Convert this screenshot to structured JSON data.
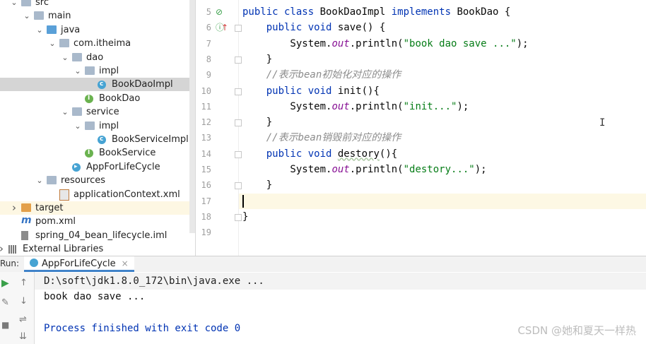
{
  "project_tree": {
    "items": [
      {
        "label": "src",
        "level": 1,
        "chevron": "down",
        "icon": "folder"
      },
      {
        "label": "main",
        "level": 2,
        "chevron": "down",
        "icon": "folder"
      },
      {
        "label": "java",
        "level": 3,
        "chevron": "down",
        "icon": "source-folder"
      },
      {
        "label": "com.itheima",
        "level": 4,
        "chevron": "down",
        "icon": "package"
      },
      {
        "label": "dao",
        "level": 5,
        "chevron": "down",
        "icon": "package"
      },
      {
        "label": "impl",
        "level": 6,
        "chevron": "down",
        "icon": "package"
      },
      {
        "label": "BookDaoImpl",
        "level": 7,
        "chevron": "",
        "icon": "class",
        "selected": true
      },
      {
        "label": "BookDao",
        "level": 6,
        "chevron": "",
        "icon": "interface"
      },
      {
        "label": "service",
        "level": 5,
        "chevron": "down",
        "icon": "package"
      },
      {
        "label": "impl",
        "level": 6,
        "chevron": "down",
        "icon": "package"
      },
      {
        "label": "BookServiceImpl",
        "level": 7,
        "chevron": "",
        "icon": "class"
      },
      {
        "label": "BookService",
        "level": 6,
        "chevron": "",
        "icon": "interface"
      },
      {
        "label": "AppForLifeCycle",
        "level": 5,
        "chevron": "",
        "icon": "run-class"
      },
      {
        "label": "resources",
        "level": 3,
        "chevron": "down",
        "icon": "resources-folder"
      },
      {
        "label": "applicationContext.xml",
        "level": 4,
        "chevron": "",
        "icon": "xml"
      },
      {
        "label": "target",
        "level": 1,
        "chevron": "right",
        "icon": "excluded-folder",
        "highlight": true
      },
      {
        "label": "pom.xml",
        "level": 1,
        "chevron": "",
        "icon": "maven"
      },
      {
        "label": "spring_04_bean_lifecycle.iml",
        "level": 1,
        "chevron": "",
        "icon": "iml"
      },
      {
        "label": "External Libraries",
        "level": 0,
        "chevron": "right",
        "icon": "library"
      }
    ]
  },
  "editor": {
    "lines": [
      {
        "num": "5",
        "segments": [
          [
            "kw",
            "public class "
          ],
          [
            "",
            "BookDaoImpl "
          ],
          [
            "kw",
            "implements "
          ],
          [
            "",
            "BookDao {"
          ]
        ]
      },
      {
        "num": "6",
        "segments": [
          [
            "",
            "    "
          ],
          [
            "kw",
            "public void "
          ],
          [
            "",
            "save() {"
          ]
        ]
      },
      {
        "num": "7",
        "segments": [
          [
            "",
            "        System."
          ],
          [
            "fld",
            "out"
          ],
          [
            "",
            ".println("
          ],
          [
            "str",
            "\"book dao save ...\""
          ],
          [
            "",
            ");"
          ]
        ]
      },
      {
        "num": "8",
        "segments": [
          [
            "",
            "    }"
          ]
        ]
      },
      {
        "num": "9",
        "segments": [
          [
            "",
            "    "
          ],
          [
            "cmt",
            "//表示bean初始化对应的操作"
          ]
        ]
      },
      {
        "num": "10",
        "segments": [
          [
            "",
            "    "
          ],
          [
            "kw",
            "public void "
          ],
          [
            "",
            "init(){"
          ]
        ]
      },
      {
        "num": "11",
        "segments": [
          [
            "",
            "        System."
          ],
          [
            "fld",
            "out"
          ],
          [
            "",
            ".println("
          ],
          [
            "str",
            "\"init...\""
          ],
          [
            "",
            ");"
          ]
        ]
      },
      {
        "num": "12",
        "segments": [
          [
            "",
            "    }"
          ]
        ]
      },
      {
        "num": "13",
        "segments": [
          [
            "",
            "    "
          ],
          [
            "cmt",
            "//表示bean销毁前对应的操作"
          ]
        ]
      },
      {
        "num": "14",
        "segments": [
          [
            "",
            "    "
          ],
          [
            "kw",
            "public void "
          ],
          [
            "und",
            "destory"
          ],
          [
            "",
            "(){"
          ]
        ]
      },
      {
        "num": "15",
        "segments": [
          [
            "",
            "        System."
          ],
          [
            "fld",
            "out"
          ],
          [
            "",
            ".println("
          ],
          [
            "str",
            "\"destory...\""
          ],
          [
            "",
            ");"
          ]
        ]
      },
      {
        "num": "16",
        "segments": [
          [
            "",
            "    }"
          ]
        ]
      },
      {
        "num": "17",
        "segments": [
          [
            "caret",
            ""
          ]
        ]
      },
      {
        "num": "18",
        "segments": [
          [
            "",
            "}"
          ]
        ]
      },
      {
        "num": "19",
        "segments": []
      }
    ],
    "current_line": "17"
  },
  "run_window": {
    "label": "Run:",
    "tab_label": "AppForLifeCycle",
    "tab_close": "×",
    "console": {
      "command": "D:\\soft\\jdk1.8.0_172\\bin\\java.exe ...",
      "output": "book dao save ...",
      "exit_message": "Process finished with exit code 0"
    }
  },
  "watermark": "CSDN @她和夏天一样热"
}
